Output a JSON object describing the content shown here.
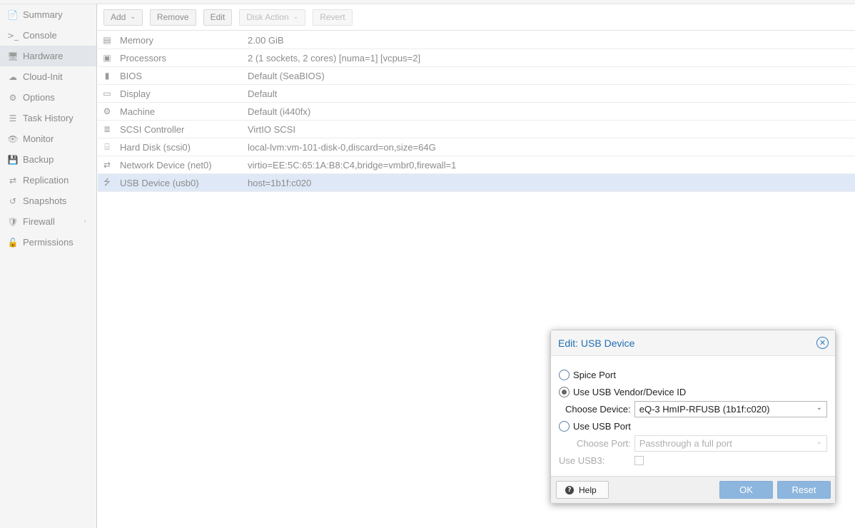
{
  "sidebar": {
    "items": [
      {
        "label": "Summary",
        "icon": "📄"
      },
      {
        "label": "Console",
        "icon": ">_"
      },
      {
        "label": "Hardware",
        "icon": "🖥"
      },
      {
        "label": "Cloud-Init",
        "icon": "☁"
      },
      {
        "label": "Options",
        "icon": "⚙"
      },
      {
        "label": "Task History",
        "icon": "☰"
      },
      {
        "label": "Monitor",
        "icon": "👁"
      },
      {
        "label": "Backup",
        "icon": "💾"
      },
      {
        "label": "Replication",
        "icon": "⇄"
      },
      {
        "label": "Snapshots",
        "icon": "↺"
      },
      {
        "label": "Firewall",
        "icon": "🛡"
      },
      {
        "label": "Permissions",
        "icon": "🔓"
      }
    ],
    "active": "Hardware",
    "firewall_arrow": "›"
  },
  "toolbar": {
    "add": "Add",
    "remove": "Remove",
    "edit": "Edit",
    "disk_action": "Disk Action",
    "revert": "Revert",
    "caret": "⌄"
  },
  "hardware": {
    "rows": [
      {
        "icon": "▤",
        "name": "Memory",
        "value": "2.00 GiB"
      },
      {
        "icon": "▣",
        "name": "Processors",
        "value": "2 (1 sockets, 2 cores) [numa=1] [vcpus=2]"
      },
      {
        "icon": "▮",
        "name": "BIOS",
        "value": "Default (SeaBIOS)"
      },
      {
        "icon": "▭",
        "name": "Display",
        "value": "Default"
      },
      {
        "icon": "⚙",
        "name": "Machine",
        "value": "Default (i440fx)"
      },
      {
        "icon": "≣",
        "name": "SCSI Controller",
        "value": "VirtIO SCSI"
      },
      {
        "icon": "⌸",
        "name": "Hard Disk (scsi0)",
        "value": "local-lvm:vm-101-disk-0,discard=on,size=64G"
      },
      {
        "icon": "⇄",
        "name": "Network Device (net0)",
        "value": "virtio=EE:5C:65:1A:B8:C4,bridge=vmbr0,firewall=1"
      },
      {
        "icon": "⭍",
        "name": "USB Device (usb0)",
        "value": "host=1b1f:c020"
      }
    ]
  },
  "modal": {
    "title": "Edit: USB Device",
    "close_icon": "✕",
    "spice_port": "Spice Port",
    "use_vendor": "Use USB Vendor/Device ID",
    "choose_device_label": "Choose Device:",
    "choose_device_value": "eQ-3 HmIP-RFUSB (1b1f:c020)",
    "use_port": "Use USB Port",
    "choose_port_label": "Choose Port:",
    "choose_port_placeholder": "Passthrough a full port",
    "use_usb3": "Use USB3:",
    "help": "Help",
    "help_icon": "?",
    "ok": "OK",
    "reset": "Reset",
    "select_arrow": "⌄"
  }
}
